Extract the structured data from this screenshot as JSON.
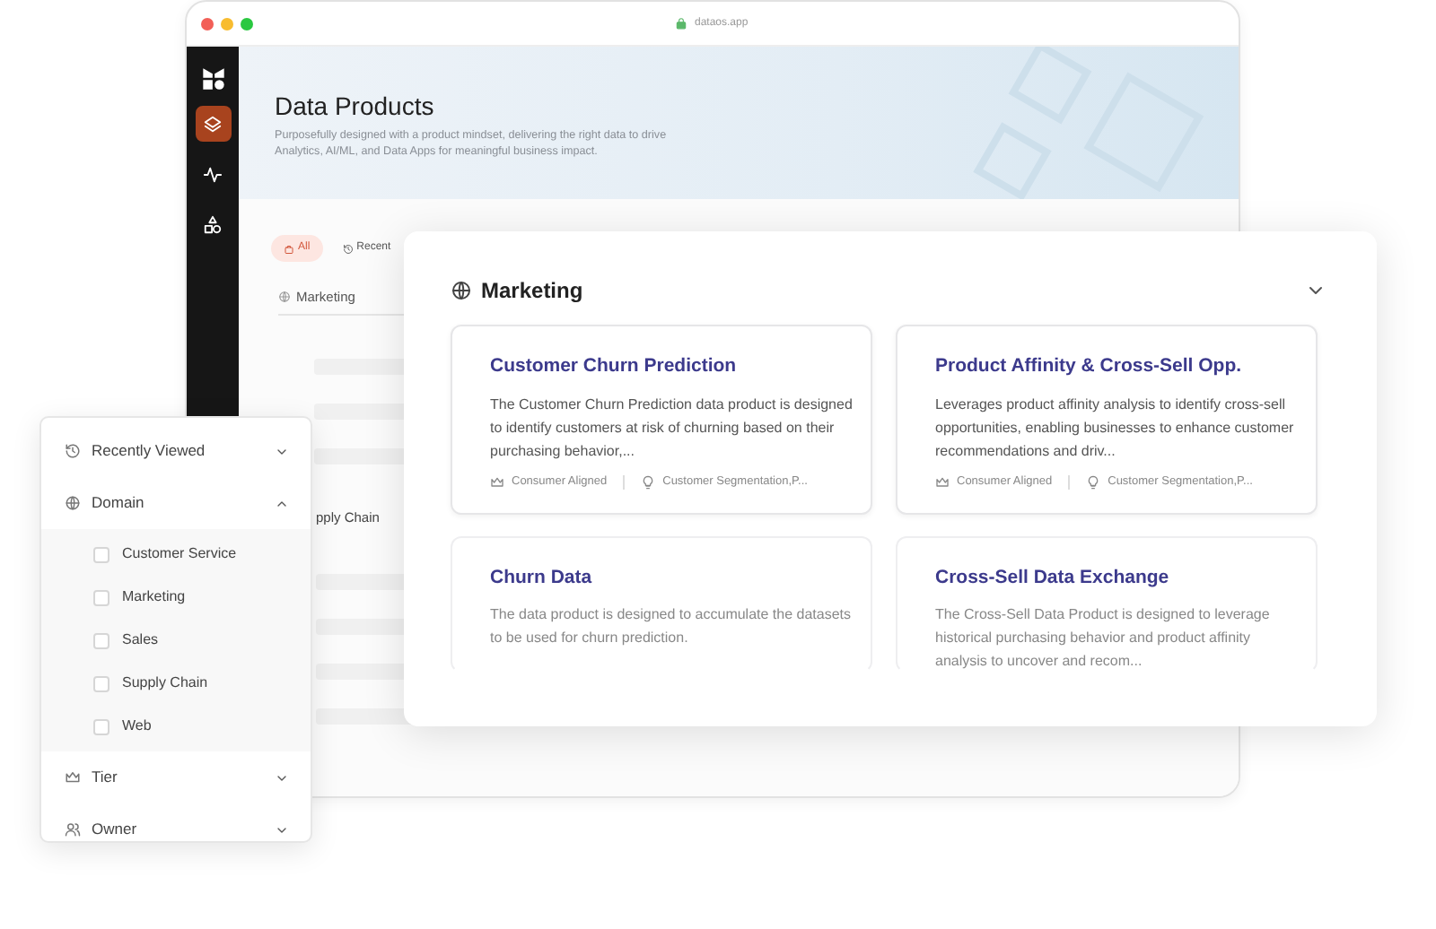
{
  "window": {
    "url": "dataos.app"
  },
  "sidebar": {
    "items": [
      {
        "kind": "layers",
        "selected": true
      },
      {
        "kind": "activity",
        "selected": false
      },
      {
        "kind": "shapes",
        "selected": false
      }
    ]
  },
  "header": {
    "title": "Data Products",
    "subtitle": "Purposefully designed with a product mindset, delivering the right data to drive Analytics, AI/ML, and Data Apps for meaningful business impact."
  },
  "chips": [
    {
      "label": "All",
      "selected": true
    },
    {
      "label": "Recent",
      "selected": false
    }
  ],
  "background_list": {
    "section": "Marketing",
    "group": "pply Chain"
  },
  "marketing_panel": {
    "title": "Marketing",
    "cards": [
      {
        "title": "Customer Churn Prediction",
        "description": "The Customer Churn Prediction data product is designed to identify customers at risk of churning based on their purchasing behavior,...",
        "tier": "Consumer Aligned",
        "use_cases": "Customer Segmentation,P..."
      },
      {
        "title": "Product Affinity & Cross-Sell Opp.",
        "description": "Leverages product affinity analysis to identify cross-sell opportunities, enabling businesses to enhance customer recommendations and driv...",
        "tier": "Consumer Aligned",
        "use_cases": "Customer Segmentation,P..."
      },
      {
        "title": "Churn Data",
        "description": "The data product is designed to accumulate the datasets to be used for churn prediction."
      },
      {
        "title": "Cross-Sell Data Exchange",
        "description": "The Cross-Sell Data Product is designed to leverage historical purchasing behavior and product affinity analysis to uncover and recom..."
      }
    ]
  },
  "filter_panel": {
    "sections": [
      {
        "kind": "history",
        "label": "Recently Viewed",
        "expanded": false
      },
      {
        "kind": "globe",
        "label": "Domain",
        "expanded": true,
        "options": [
          {
            "label": "Customer Service",
            "checked": false
          },
          {
            "label": "Marketing",
            "checked": false
          },
          {
            "label": "Sales",
            "checked": false
          },
          {
            "label": "Supply Chain",
            "checked": false
          },
          {
            "label": "Web",
            "checked": false
          }
        ]
      },
      {
        "kind": "crown",
        "label": "Tier",
        "expanded": false
      },
      {
        "kind": "users",
        "label": "Owner",
        "expanded": false
      }
    ]
  }
}
